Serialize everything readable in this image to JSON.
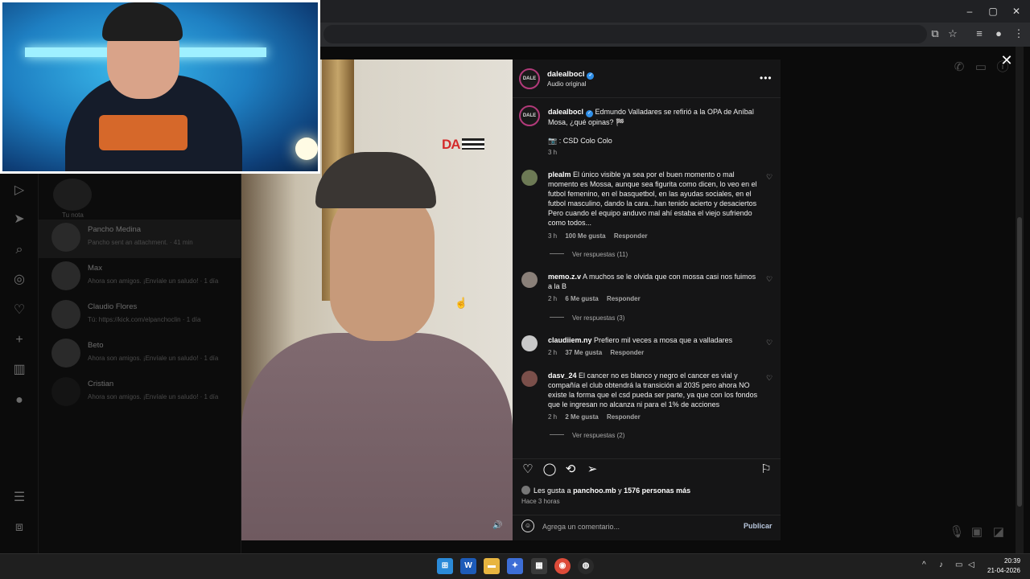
{
  "browser": {
    "window_buttons": {
      "minimize": "–",
      "maximize": "▢",
      "close": "✕"
    }
  },
  "sidebar_nav": {
    "icons": [
      "reels-icon",
      "messages-icon",
      "search-icon",
      "explore-icon",
      "heart-icon",
      "create-icon",
      "dashboard-icon",
      "profile-icon",
      "menu-icon",
      "threads-icon"
    ]
  },
  "inbox": {
    "note_label": "Tu nota",
    "chats": [
      {
        "name": "Pancho Medina",
        "preview": "Pancho sent an attachment. · 41 min"
      },
      {
        "name": "Max",
        "preview": "Ahora son amigos. ¡Envíale un saludo! · 1 día"
      },
      {
        "name": "Claudio Flores",
        "preview": "Tú: https://kick.com/elpanchoclin · 1 día"
      },
      {
        "name": "Beto",
        "preview": "Ahora son amigos. ¡Envíale un saludo! · 1 día"
      },
      {
        "name": "Cristian",
        "preview": "Ahora son amigos. ¡Envíale un saludo! · 1 día"
      }
    ]
  },
  "video": {
    "overlay_logo": "DA"
  },
  "post": {
    "avatar_text": "DALE",
    "username": "dalealbocl",
    "audio": "Audio original",
    "caption_user": "dalealbocl",
    "caption": "Edmundo Valladares se refirió a la OPA de Aníbal Mosa, ¿qué opinas? 🏁",
    "caption_credit": "📷 : CSD Colo Colo",
    "caption_time": "3 h",
    "comments": [
      {
        "user": "plealm",
        "text": "El único visible ya sea por el buen momento o mal momento es Mossa, aunque sea figurita como dicen, lo veo en el futbol femenino, en el basquetbol, en las ayudas sociales, en el futbol masculino, dando la cara...han tenido acierto y desaciertos Pero cuando el equipo anduvo mal ahí estaba el viejo sufriendo como todos...",
        "time": "3 h",
        "likes": "100 Me gusta",
        "reply": "Responder",
        "view_replies": "Ver respuestas (11)"
      },
      {
        "user": "memo.z.v",
        "text": "A muchos se le olvida que con mossa casi nos fuimos a la B",
        "time": "2 h",
        "likes": "6 Me gusta",
        "reply": "Responder",
        "view_replies": "Ver respuestas (3)"
      },
      {
        "user": "claudiiem.ny",
        "text": "Prefiero mil veces a mosa que a valladares",
        "time": "2 h",
        "likes": "37 Me gusta",
        "reply": "Responder"
      },
      {
        "user": "dasv_24",
        "text": "El cancer no es blanco y negro el cancer es vial y compañía el club obtendrá la transición al 2035 pero ahora NO existe la forma que el csd pueda ser parte, ya que con los fondos que le ingresan no alcanza ni para el 1% de acciones",
        "time": "2 h",
        "likes": "2 Me gusta",
        "reply": "Responder",
        "view_replies": "Ver respuestas (2)"
      }
    ],
    "likes_prefix": "Les gusta a",
    "likes_user": "panchoo.mb",
    "likes_connector": "y",
    "likes_others": "1576 personas más",
    "posted_ago": "Hace 3 horas",
    "comment_placeholder": "Agrega un comentario...",
    "publish_label": "Publicar"
  },
  "taskbar": {
    "clock_time": "20:39",
    "clock_date": "21-04-2026",
    "tray_arrow": "^"
  }
}
